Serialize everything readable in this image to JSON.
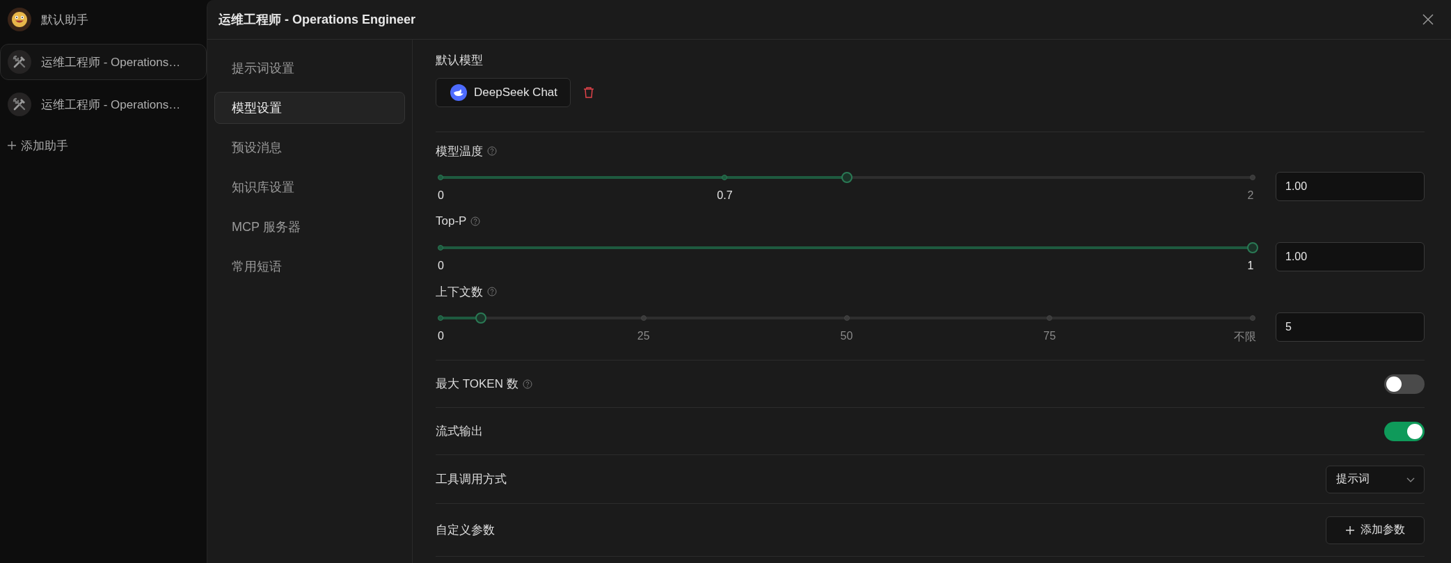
{
  "sidebar": {
    "items": [
      {
        "name": "默认助手",
        "kind": "smile",
        "selected": false
      },
      {
        "name": "运维工程师 - Operations…",
        "kind": "tools",
        "selected": true
      },
      {
        "name": "运维工程师 - Operations…",
        "kind": "tools",
        "selected": false
      }
    ],
    "add_button": "添加助手"
  },
  "dialog": {
    "title": "运维工程师 - Operations Engineer",
    "nav": [
      {
        "label": "提示词设置",
        "selected": false
      },
      {
        "label": "模型设置",
        "selected": true
      },
      {
        "label": "预设消息",
        "selected": false
      },
      {
        "label": "知识库设置",
        "selected": false
      },
      {
        "label": "MCP 服务器",
        "selected": false
      },
      {
        "label": "常用短语",
        "selected": false
      }
    ],
    "default_model": {
      "label": "默认模型",
      "model": "DeepSeek Chat"
    },
    "sliders": [
      {
        "label": "模型温度",
        "help": true,
        "level": 0.5,
        "value": "1.00",
        "ticks": [
          "0",
          "0.7",
          "2"
        ]
      },
      {
        "label": "Top-P",
        "help": true,
        "level": 1,
        "value": "1.00",
        "ticks": [
          "0",
          "1"
        ]
      },
      {
        "label": "上下文数",
        "help": true,
        "level": 0.05,
        "value": "5",
        "ticks": [
          "0",
          "25",
          "50",
          "75",
          "不限"
        ]
      }
    ],
    "rows": [
      {
        "kind": "toggle",
        "label": "最大 TOKEN 数",
        "help": true,
        "on": false
      },
      {
        "kind": "toggle",
        "label": "流式输出",
        "help": false,
        "on": true
      },
      {
        "kind": "select",
        "label": "工具调用方式",
        "help": false,
        "value": "提示词"
      },
      {
        "kind": "button",
        "label": "自定义参数",
        "help": false,
        "button": "添加参数"
      }
    ]
  }
}
